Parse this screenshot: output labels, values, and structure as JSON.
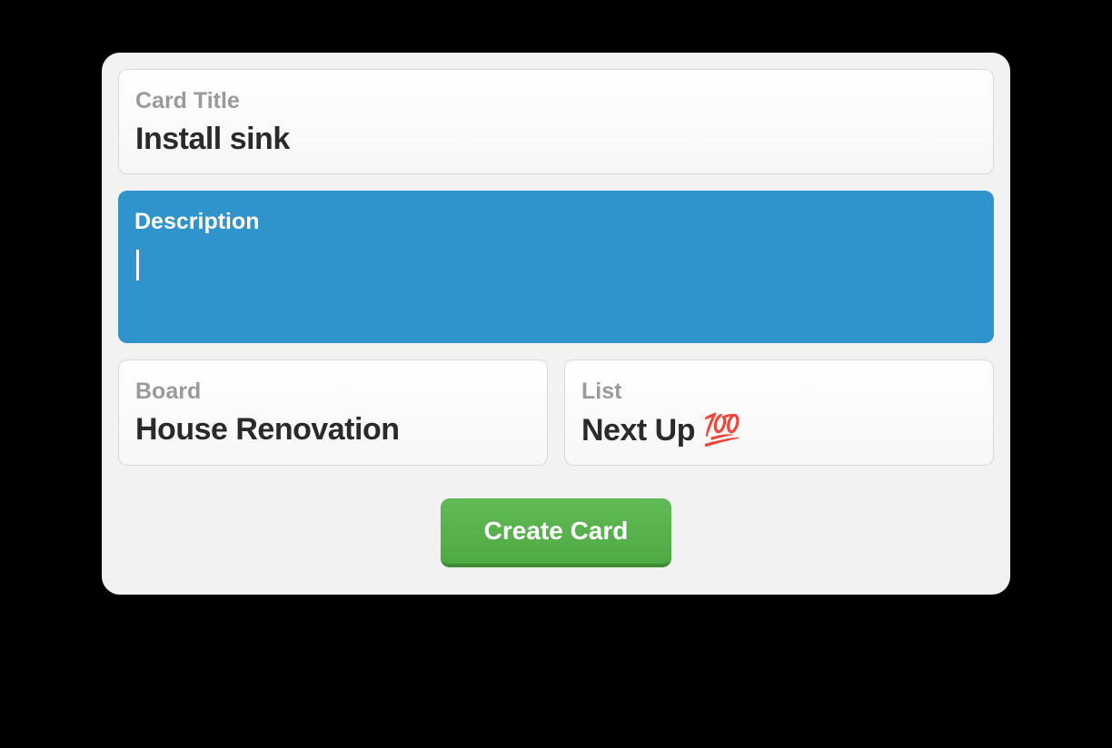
{
  "card_title": {
    "label": "Card Title",
    "value": "Install sink"
  },
  "description": {
    "label": "Description",
    "value": ""
  },
  "board": {
    "label": "Board",
    "value": "House Renovation"
  },
  "list": {
    "label": "List",
    "value": "Next Up 💯"
  },
  "actions": {
    "create_label": "Create Card"
  }
}
